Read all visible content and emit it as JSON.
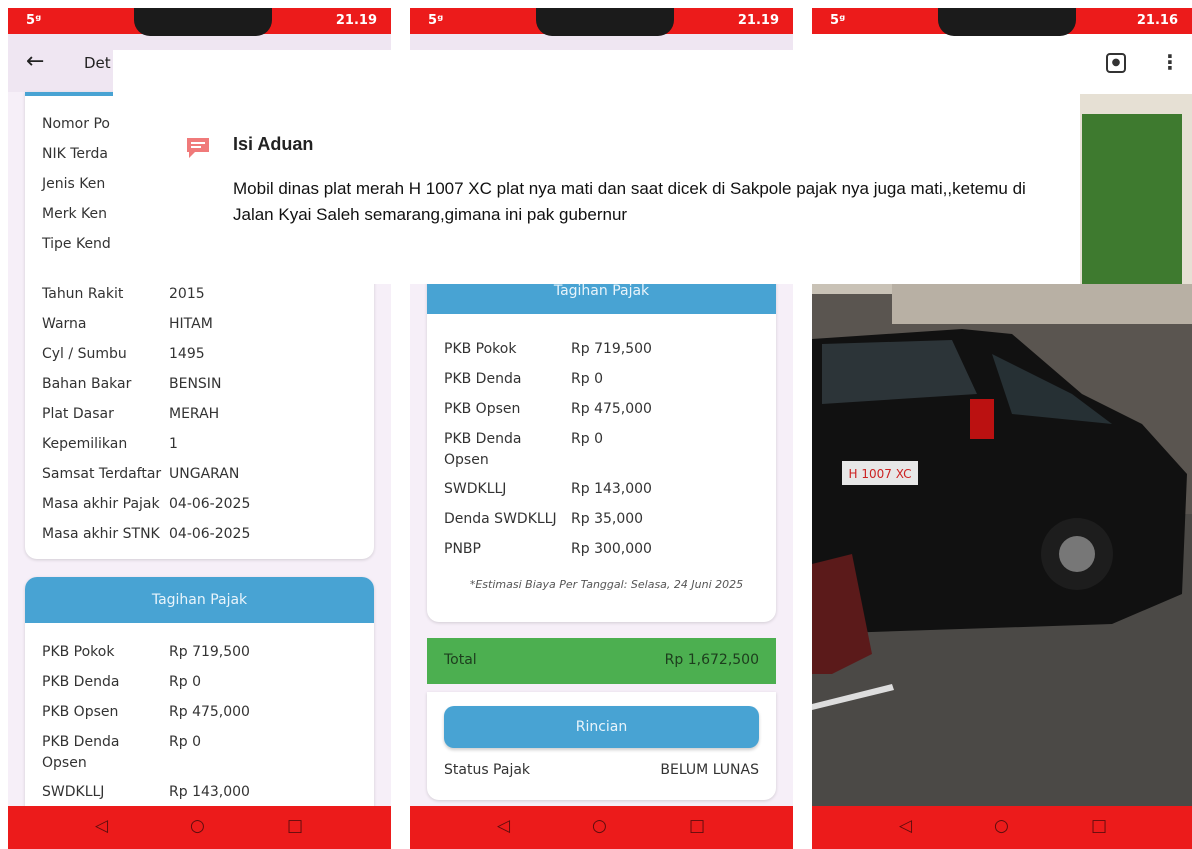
{
  "phone1": {
    "status": {
      "signal": "5ᵍ",
      "time": "21.19"
    },
    "appbar": {
      "title": "Det"
    },
    "vehicle_rows": [
      {
        "k": "Nomor Po",
        "v": ""
      },
      {
        "k": "NIK Terda",
        "v": ""
      },
      {
        "k": "Jenis Ken",
        "v": ""
      },
      {
        "k": "Merk Ken",
        "v": ""
      },
      {
        "k": "Tipe Kend",
        "v": ""
      },
      {
        "k": "Tahun Rakit",
        "v": "2015"
      },
      {
        "k": "Warna",
        "v": "HITAM"
      },
      {
        "k": "Cyl / Sumbu",
        "v": "1495"
      },
      {
        "k": "Bahan Bakar",
        "v": "BENSIN"
      },
      {
        "k": "Plat Dasar",
        "v": "MERAH"
      },
      {
        "k": "Kepemilikan",
        "v": "1"
      },
      {
        "k": "Samsat Terdaftar",
        "v": "UNGARAN"
      },
      {
        "k": "Masa akhir Pajak",
        "v": "04-06-2025"
      },
      {
        "k": "Masa akhir STNK",
        "v": "04-06-2025"
      }
    ],
    "tax_header": "Tagihan Pajak",
    "tax_rows": [
      {
        "k": "PKB Pokok",
        "v": "Rp 719,500"
      },
      {
        "k": "PKB Denda",
        "v": "Rp 0"
      },
      {
        "k": "PKB Opsen",
        "v": "Rp 475,000"
      },
      {
        "k": "PKB Denda",
        "k2": "Opsen",
        "v": "Rp 0"
      },
      {
        "k": "SWDKLLJ",
        "v": "Rp 143,000"
      }
    ]
  },
  "phone2": {
    "status": {
      "signal": "5ᵍ",
      "time": "21.19"
    },
    "tax_header": "Tagihan Pajak",
    "tax_rows": [
      {
        "k": "PKB Pokok",
        "v": "Rp 719,500"
      },
      {
        "k": "PKB Denda",
        "v": "Rp 0"
      },
      {
        "k": "PKB Opsen",
        "v": "Rp 475,000"
      },
      {
        "k": "PKB Denda",
        "k2": "Opsen",
        "v": "Rp 0"
      },
      {
        "k": "SWDKLLJ",
        "v": "Rp 143,000"
      },
      {
        "k": "Denda SWDKLLJ",
        "v": "Rp 35,000"
      },
      {
        "k": "PNBP",
        "v": "Rp 300,000"
      }
    ],
    "estimate_note": "*Estimasi Biaya Per Tanggal: Selasa, 24 Juni 2025",
    "total_label": "Total",
    "total_value": "Rp 1,672,500",
    "detail_button": "Rincian",
    "status_label": "Status Pajak",
    "status_value": "BELUM LUNAS"
  },
  "phone3": {
    "status": {
      "signal": "5ᵍ",
      "time": "21.16"
    },
    "plate_text": "H 1007 XC"
  },
  "complaint": {
    "title": "Isi Aduan",
    "text": "Mobil dinas plat merah H 1007 XC plat nya mati dan saat dicek di Sakpole pajak nya juga mati,,ketemu di Jalan Kyai Saleh semarang,gimana ini pak gubernur"
  },
  "nav_icons": [
    "back-triangle-icon",
    "home-circle-icon",
    "recents-square-icon"
  ],
  "colors": {
    "status_red": "#ec1b1b",
    "header_blue": "#48a3d3",
    "total_green": "#4caf50"
  }
}
